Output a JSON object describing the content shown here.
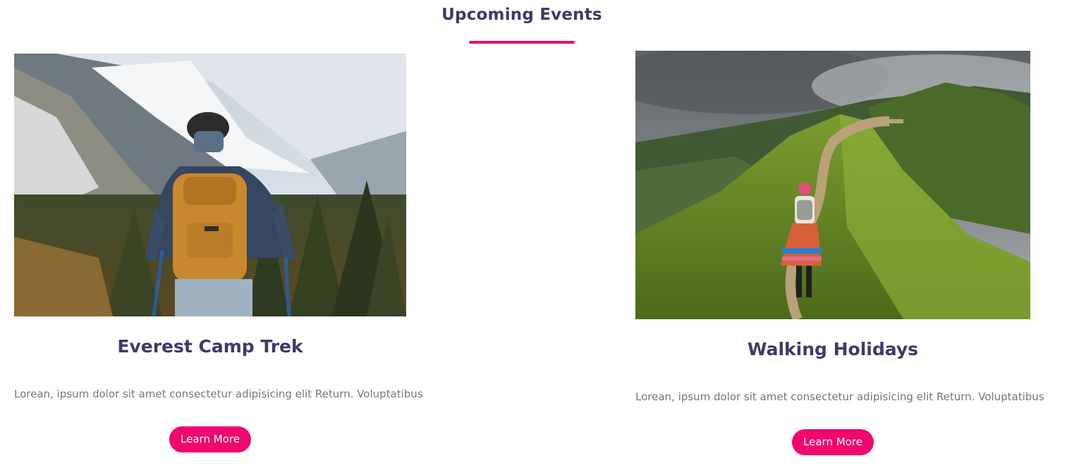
{
  "section": {
    "title": "Upcoming Events",
    "accent_color": "#f0066f",
    "heading_color": "#3d3a6b"
  },
  "events": [
    {
      "title": "Everest Camp Trek",
      "description": "Lorean, ipsum dolor sit amet consectetur adipisicing elit Return. Voluptatibus",
      "button_label": "Learn More",
      "image": "hiker-with-orange-backpack-snowy-mountains-photo"
    },
    {
      "title": "Walking Holidays",
      "description": "Lorean, ipsum dolor sit amet consectetur adipisicing elit Return. Voluptatibus",
      "button_label": "Learn More",
      "image": "woman-walking-green-ridge-trail-photo"
    }
  ]
}
